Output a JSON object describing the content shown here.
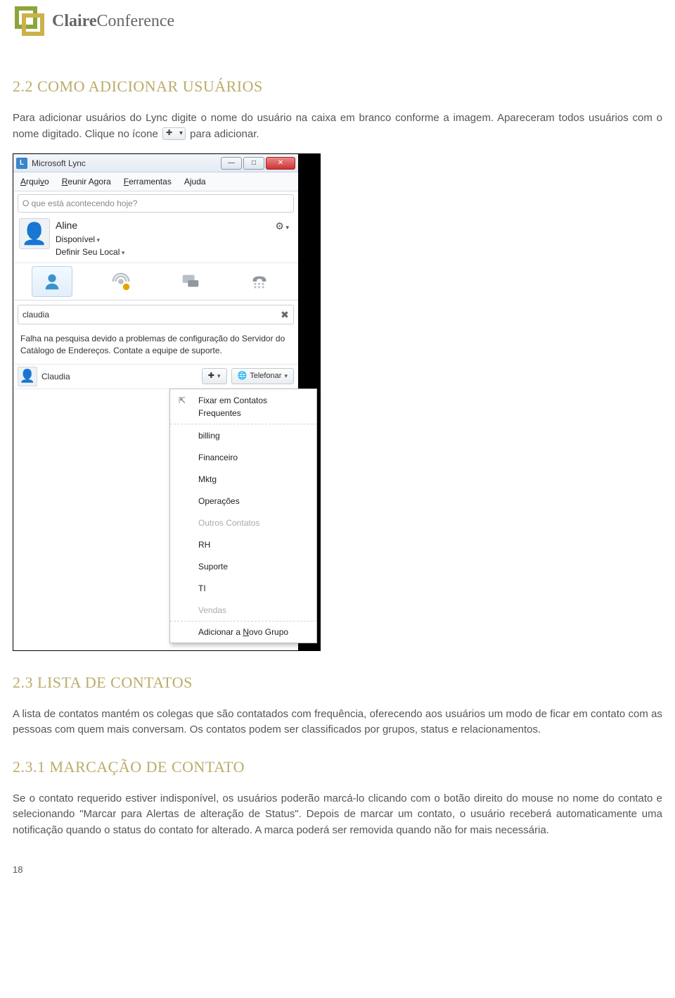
{
  "brand": {
    "name_bold": "Claire",
    "name_light": "Conference"
  },
  "section1": {
    "title": "2.2 COMO ADICIONAR USUÁRIOS",
    "p1a": "Para adicionar usuários do Lync digite o nome do usuário na caixa em branco conforme a imagem. Apareceram todos usuários com o nome digitado. Clique no ícone ",
    "p1b": " para adicionar."
  },
  "lync": {
    "title": "Microsoft Lync",
    "menus": [
      "Arquivo",
      "Reunir Agora",
      "Ferramentas",
      "Ajuda"
    ],
    "status_placeholder": "O que está acontecendo hoje?",
    "profile": {
      "name": "Aline",
      "presence": "Disponível",
      "location": "Definir Seu Local"
    },
    "tabs": [
      "contacts",
      "activity",
      "conversations",
      "phone"
    ],
    "search_value": "claudia",
    "error_msg": "Falha na pesquisa devido a problemas de configuração do Servidor do Catálogo de Endereços. Contate a equipe de suporte.",
    "result_name": "Claudia",
    "call_label": "Telefonar",
    "ctx": {
      "head": "Fixar em Contatos Frequentes",
      "items": [
        "billing",
        "Financeiro",
        "Mktg",
        "Operações",
        "Outros Contatos",
        "RH",
        "Suporte",
        "TI",
        "Vendas"
      ],
      "disabled": [
        "Outros Contatos",
        "Vendas"
      ],
      "footer": "Adicionar a Novo Grupo"
    }
  },
  "section2": {
    "title": "2.3 LISTA DE CONTATOS",
    "p": "A lista de contatos mantém os colegas que são contatados com frequência, oferecendo aos usuários um modo de ficar em contato com as pessoas com quem mais conversam. Os contatos podem ser classificados por grupos, status e relacionamentos."
  },
  "section3": {
    "title": "2.3.1 MARCAÇÃO DE CONTATO",
    "p": "Se o contato requerido estiver indisponível, os usuários poderão marcá-lo clicando com o botão direito do mouse no nome do contato e selecionando \"Marcar para Alertas de alteração de Status\". Depois de marcar um contato, o usuário receberá automaticamente uma notificação quando o status do contato for alterado. A marca poderá ser removida quando não for mais necessária."
  },
  "page_number": "18"
}
